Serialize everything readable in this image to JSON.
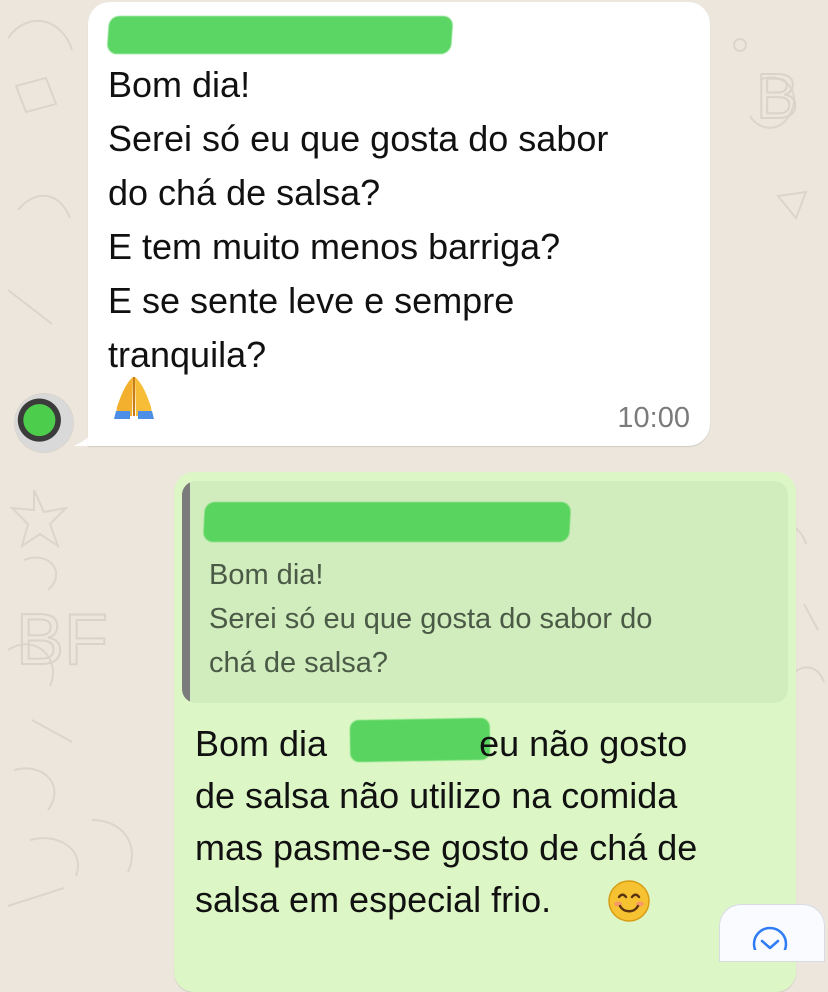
{
  "conversation": {
    "incoming_message": {
      "lines": [
        "Bom dia!",
        "Serei só eu que gosta do sabor",
        "do chá de salsa?",
        "E tem muito menos barriga?",
        "E se sente leve e sempre",
        "tranquila?"
      ],
      "emoji": "🙏",
      "time": "10:00"
    },
    "outgoing_message": {
      "quoted_lines": [
        "Bom dia!",
        "Serei só eu que gosta do sabor do",
        "chá de salsa?"
      ],
      "reply_start": "Bom dia",
      "reply_after_name": "eu não gosto",
      "reply_lines": [
        "de salsa não utilizo na comida",
        "mas pasme-se gosto de chá de",
        "salsa em especial frio."
      ],
      "reply_emoji": "😊"
    }
  },
  "colors": {
    "chat_background": "#ece6dd",
    "incoming_bubble": "#ffffff",
    "outgoing_bubble": "#dcf7c5",
    "quote_background": "#d1edbd",
    "redaction_green": "#53d35b"
  },
  "icons": {
    "pray": "folded-hands-icon",
    "smile": "smiling-face-icon",
    "scroll": "chevron-down-icon"
  }
}
